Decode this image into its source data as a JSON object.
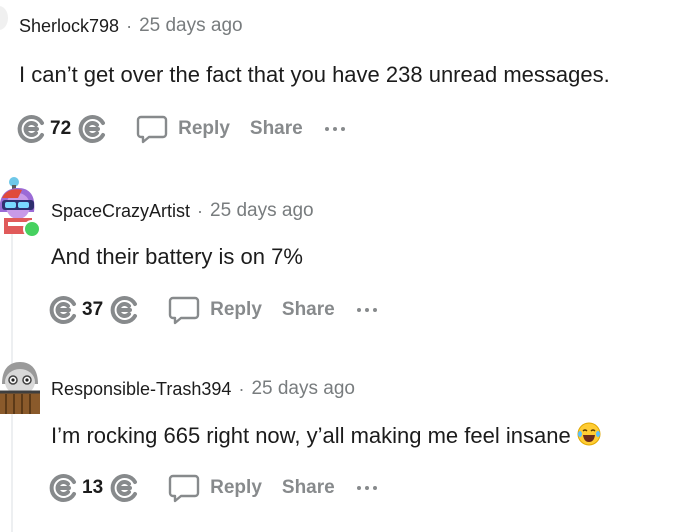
{
  "comments": [
    {
      "username": "Sherlock798",
      "separator": "·",
      "time": "25 days ago",
      "body": "I can’t get over the fact that you have 238 unread messages.",
      "score": "72",
      "reply_label": "Reply",
      "share_label": "Share"
    },
    {
      "username": "SpaceCrazyArtist",
      "separator": "·",
      "time": "25 days ago",
      "body": "And their battery is on 7%",
      "score": "37",
      "reply_label": "Reply",
      "share_label": "Share"
    },
    {
      "username": "Responsible-Trash394",
      "separator": "·",
      "time": "25 days ago",
      "body": "I’m rocking 665 right now, y’all making me feel insane",
      "score": "13",
      "reply_label": "Reply",
      "share_label": "Share",
      "emoji": "laughing-tears-emoji"
    }
  ],
  "colors": {
    "meta_gray": "#787c7e",
    "action_gray": "#878a8c",
    "text": "#1c1c1c",
    "online": "#46d160"
  }
}
